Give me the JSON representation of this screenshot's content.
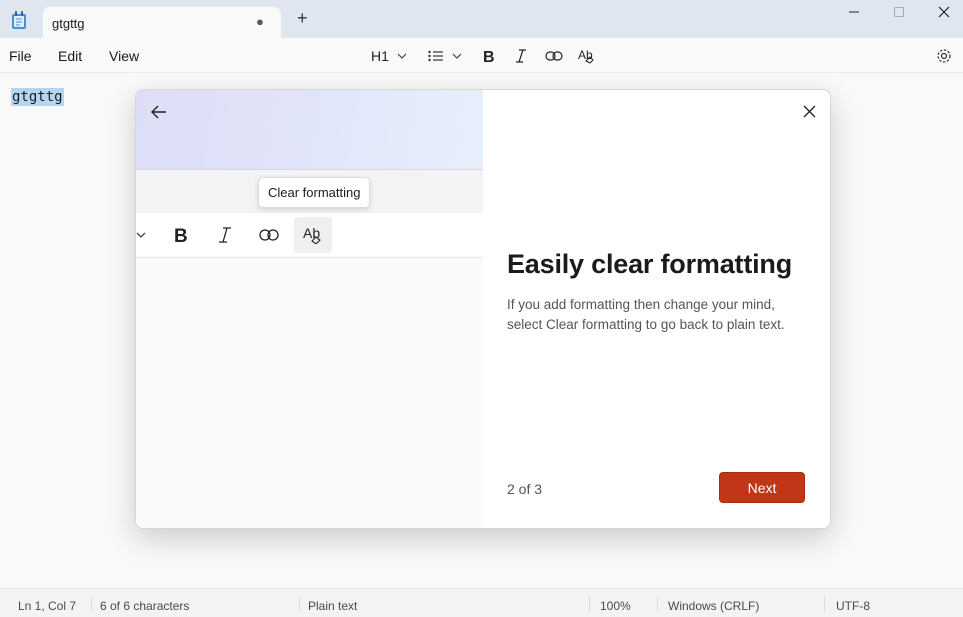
{
  "tab": {
    "title": "gtgttg",
    "unsaved_marker": "●",
    "new_tab": "+"
  },
  "menu": {
    "file": "File",
    "edit": "Edit",
    "view": "View"
  },
  "toolbar": {
    "heading_label": "H1"
  },
  "editor": {
    "text": "gtgttg"
  },
  "dialog": {
    "tooltip": "Clear formatting",
    "heading": "Easily clear formatting",
    "description": "If you add formatting then change your mind, select Clear formatting to go back to plain text.",
    "step": "2 of 3",
    "next_label": "Next"
  },
  "status": {
    "position": "Ln 1, Col 7",
    "characters": "6 of 6 characters",
    "format": "Plain text",
    "zoom": "100%",
    "line_ending": "Windows (CRLF)",
    "encoding": "UTF-8"
  },
  "colors": {
    "accent": "#c03616",
    "selection": "#b6d5f2",
    "titlebar": "#dfe6f0"
  },
  "icons": [
    "notepad-icon",
    "minimize-icon",
    "maximize-icon",
    "close-icon",
    "chevron-down-icon",
    "list-icon",
    "bold-icon",
    "italic-icon",
    "link-icon",
    "clear-formatting-icon",
    "settings-icon",
    "back-arrow-icon"
  ]
}
